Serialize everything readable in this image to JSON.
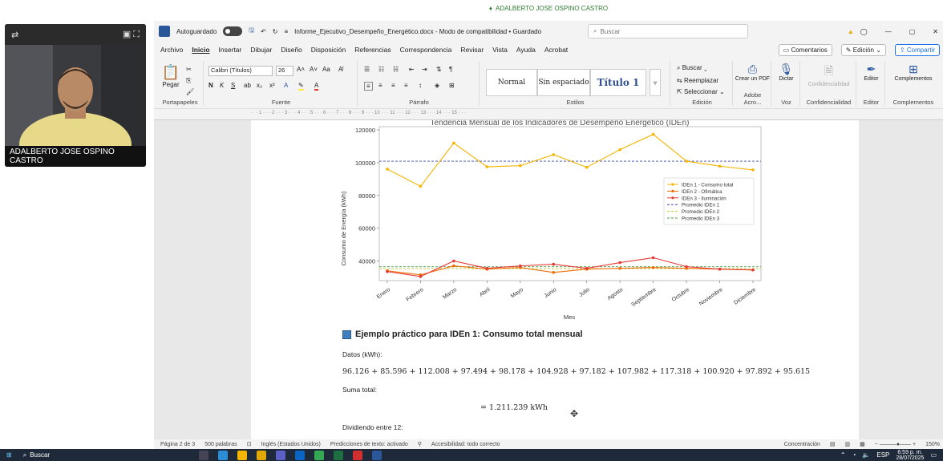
{
  "presenter_bar": {
    "label": "ADALBERTO JOSE OSPINO CASTRO"
  },
  "video": {
    "participant_name": "ADALBERTO JOSE OSPINO CASTRO"
  },
  "titlebar": {
    "autosave_label": "Autoguardado",
    "file_title": "Informe_Ejecutivo_Desempeño_Energético.docx - Modo de compatibilidad • Guardado",
    "search_placeholder": "Buscar"
  },
  "menu": {
    "items": [
      "Archivo",
      "Inicio",
      "Insertar",
      "Dibujar",
      "Diseño",
      "Disposición",
      "Referencias",
      "Correspondencia",
      "Revisar",
      "Vista",
      "Ayuda",
      "Acrobat"
    ],
    "comments_label": "Comentarios",
    "edit_label": "Edición",
    "share_label": "Compartir"
  },
  "ribbon": {
    "paste_label": "Pegar",
    "clipboard_group": "Portapapeles",
    "font_name": "Calibri (Títulos)",
    "font_size": "26",
    "font_group": "Fuente",
    "paragraph_group": "Párrafo",
    "styles": [
      "Normal",
      "Sin espaciado",
      "Título 1"
    ],
    "styles_group": "Estilos",
    "find_label": "Buscar",
    "replace_label": "Reemplazar",
    "select_label": "Seleccionar",
    "edit_group": "Edición",
    "create_pdf_label": "Crear un PDF",
    "adobe_group": "Adobe Acro...",
    "dictate_label": "Dictar",
    "voice_group": "Voz",
    "confidential_label": "Confidencialidad",
    "confidential_group": "Confidencialidad",
    "editor_label": "Editor",
    "editor_group": "Editor",
    "addins_label": "Complementos",
    "addins_group": "Complementos"
  },
  "chart_data": {
    "type": "line",
    "title": "Tendencia Mensual de los Indicadores de Desempeño Energético (IDEn)",
    "xlabel": "Mes",
    "ylabel": "Consumo de Energía (kWh)",
    "ylim": [
      28000,
      122000
    ],
    "yticks": [
      40000,
      60000,
      80000,
      100000,
      120000
    ],
    "categories": [
      "Enero",
      "Febrero",
      "Marzo",
      "Abril",
      "Mayo",
      "Junio",
      "Julio",
      "Agosto",
      "Septiembre",
      "Octubre",
      "Noviembre",
      "Diciembre"
    ],
    "series": [
      {
        "name": "IDEn 1 - Consumo total",
        "color": "#f4b400",
        "values": [
          96126,
          85596,
          112008,
          97494,
          98178,
          104928,
          97182,
          107982,
          117318,
          100920,
          97892,
          95615
        ]
      },
      {
        "name": "IDEn 2 - Ofimática",
        "color": "#ef6c00",
        "values": [
          34000,
          31500,
          37000,
          35000,
          36000,
          33000,
          35000,
          35500,
          36000,
          35500,
          35000,
          34500
        ]
      },
      {
        "name": "IDEn 3 - Iluminación",
        "color": "#e53935",
        "values": [
          33500,
          30500,
          40000,
          35500,
          37000,
          38000,
          35500,
          39000,
          42000,
          36500,
          35000,
          34500
        ]
      }
    ],
    "references": [
      {
        "name": "Promedio IDEn 1",
        "color": "#3949ab",
        "value": 100937
      },
      {
        "name": "Promedio IDEn 2",
        "color": "#c0ca33",
        "value": 35292
      },
      {
        "name": "Promedio IDEn 3",
        "color": "#43a047",
        "value": 36458
      }
    ],
    "legend_position": "center-right",
    "grid": false
  },
  "document": {
    "heading": "Ejemplo práctico para IDEn 1: Consumo total mensual",
    "data_label": "Datos (kWh):",
    "equation": "96.126 + 85.596 + 112.008 + 97.494 + 98.178 + 104.928 + 97.182 + 107.982 + 117.318 + 100.920 + 97.892 + 95.615",
    "sum_label": "Suma total:",
    "sum_value": "= 1.211.239 kWh",
    "divide_label": "Dividiendo entre 12:"
  },
  "status": {
    "page": "Página 2 de 3",
    "words": "500 palabras",
    "language": "Inglés (Estados Unidos)",
    "predictions": "Predicciones de texto: activado",
    "accessibility": "Accesibilidad: todo correcto",
    "focus": "Concentración",
    "zoom": "150%"
  },
  "taskbar": {
    "search_placeholder": "Buscar",
    "language": "ESP",
    "time": "6:59 p. m.",
    "date": "28/07/2025"
  }
}
